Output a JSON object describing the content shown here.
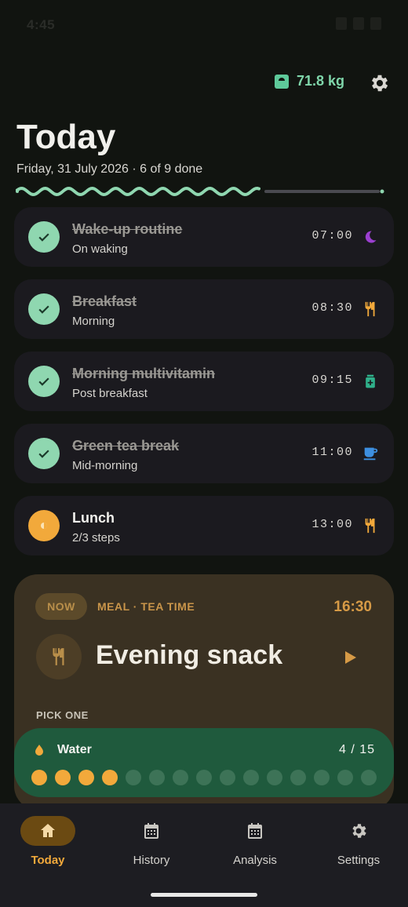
{
  "status_bar": {
    "time": "4:45"
  },
  "header": {
    "weight": "71.8 kg",
    "title": "Today",
    "subtitle": "Friday, 31 July 2026 · 6 of 9 done",
    "progress_fraction": 0.6667
  },
  "tasks": [
    {
      "name": "Wake-up routine",
      "sub": "On waking",
      "time": "07:00",
      "icon": "moon-icon",
      "done": true
    },
    {
      "name": "Breakfast",
      "sub": "Morning",
      "time": "08:30",
      "icon": "fork-knife-icon",
      "done": true
    },
    {
      "name": "Morning multivitamin",
      "sub": "Post breakfast",
      "time": "09:15",
      "icon": "pill-bottle-icon",
      "done": true
    },
    {
      "name": "Green tea break",
      "sub": "Mid-morning",
      "time": "11:00",
      "icon": "cup-icon",
      "done": true
    },
    {
      "name": "Lunch",
      "sub": "2/3 steps",
      "time": "13:00",
      "icon": "fork-knife-icon",
      "done": false
    }
  ],
  "current": {
    "badge": "NOW",
    "label": "MEAL · TEA TIME",
    "time": "16:30",
    "title": "Evening snack",
    "pick_label": "PICK ONE"
  },
  "water": {
    "label": "Water",
    "count": "4 / 15",
    "filled": 4,
    "total": 15
  },
  "nav": {
    "items": [
      {
        "label": "Today",
        "icon": "home-icon",
        "active": true
      },
      {
        "label": "History",
        "icon": "calendar-icon",
        "active": false
      },
      {
        "label": "Analysis",
        "icon": "calendar-icon",
        "active": false
      },
      {
        "label": "Settings",
        "icon": "gear-icon",
        "active": false
      }
    ]
  },
  "colors": {
    "accent_orange": "#f2a93b",
    "done_green": "#8fd7b0",
    "water_green": "#1f5a3d",
    "weight_green": "#7fd6aa"
  }
}
